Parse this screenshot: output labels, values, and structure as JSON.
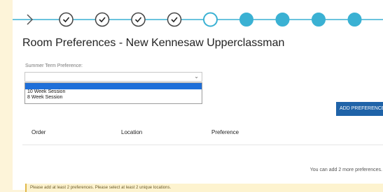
{
  "progress": {
    "steps": [
      {
        "state": "arrow"
      },
      {
        "state": "complete",
        "icon": "check-icon"
      },
      {
        "state": "complete",
        "icon": "check-icon"
      },
      {
        "state": "complete",
        "icon": "check-icon"
      },
      {
        "state": "complete",
        "icon": "check-icon"
      },
      {
        "state": "current"
      },
      {
        "state": "upcoming"
      },
      {
        "state": "upcoming"
      },
      {
        "state": "upcoming"
      },
      {
        "state": "upcoming"
      },
      {
        "state": "upcoming"
      }
    ],
    "colors": {
      "line": "#3ab1d3",
      "complete_border": "#444444",
      "current_border": "#3ab1d3",
      "upcoming_fill": "#3ab1d3"
    }
  },
  "page": {
    "title": "Room Preferences - New Kennesaw Upperclassman"
  },
  "summer_term": {
    "label": "Summer Term Preference:",
    "selected_value": "",
    "options": [
      "",
      "10 Week Session",
      "8 Week Session"
    ]
  },
  "actions": {
    "add_preference_label": "ADD PREFERENCE",
    "accent_color": "#1f63a8"
  },
  "preferences_table": {
    "columns": [
      "Order",
      "Location",
      "Preference"
    ],
    "rows": []
  },
  "remaining_text": "You can add 2 more preferences.",
  "alert": {
    "text": "Please add at least 2 preferences. Please select at least 2 unique locations."
  }
}
